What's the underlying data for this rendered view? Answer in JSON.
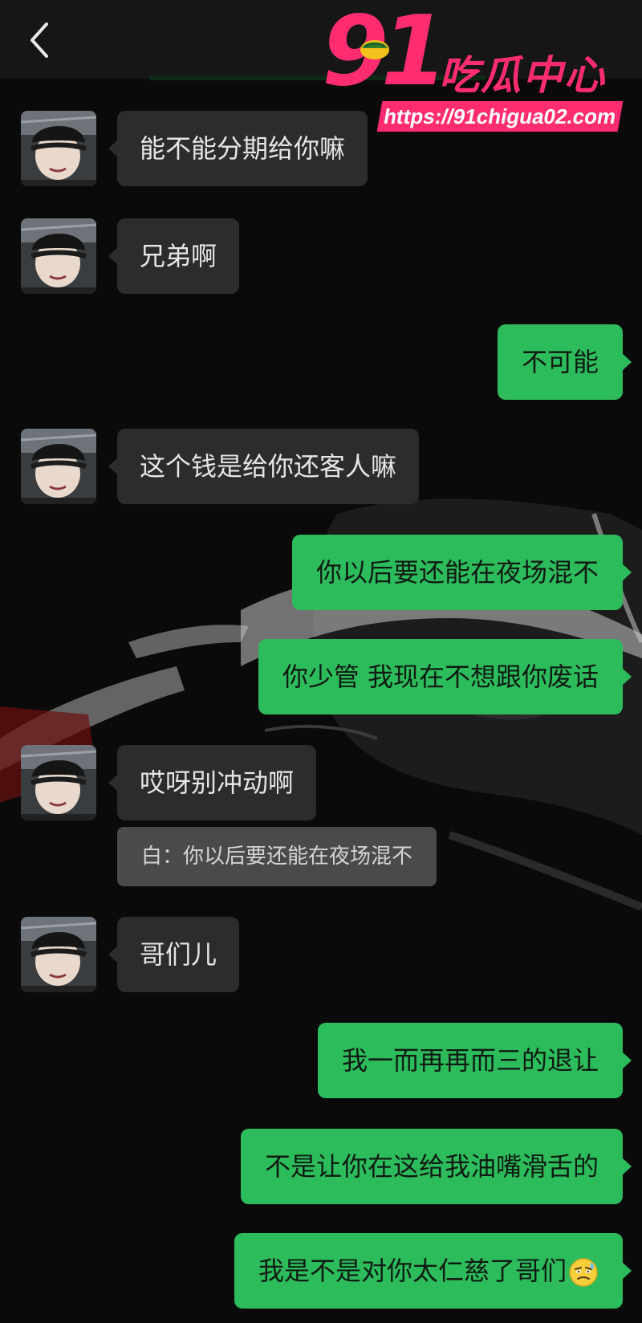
{
  "colors": {
    "background": "#0a0a0a",
    "incoming_bubble": "#2c2c2c",
    "outgoing_bubble": "#2dbc5c",
    "quote_bubble": "#4a4a4a",
    "watermark": "#ff2d6f"
  },
  "header": {
    "back_icon": "chevron-left-icon"
  },
  "watermark": {
    "number": "91",
    "name": "吃瓜中心",
    "url": "https://91chigua02.com"
  },
  "messages": [
    {
      "side": "incoming",
      "text": "能不能分期给你嘛"
    },
    {
      "side": "incoming",
      "text": "兄弟啊"
    },
    {
      "side": "outgoing",
      "text": "不可能"
    },
    {
      "side": "incoming",
      "text": "这个钱是给你还客人嘛"
    },
    {
      "side": "outgoing",
      "text": "你以后要还能在夜场混不"
    },
    {
      "side": "outgoing",
      "text": "你少管 我现在不想跟你废话"
    },
    {
      "side": "incoming",
      "text": "哎呀别冲动啊",
      "quote": "白：你以后要还能在夜场混不"
    },
    {
      "side": "incoming",
      "text": "哥们儿"
    },
    {
      "side": "outgoing",
      "text": "我一而再再而三的退让"
    },
    {
      "side": "outgoing",
      "text": "不是让你在这给我油嘴滑舌的"
    },
    {
      "side": "outgoing",
      "text": "我是不是对你太仁慈了哥们",
      "emoji": "sweat-smile-icon"
    }
  ]
}
